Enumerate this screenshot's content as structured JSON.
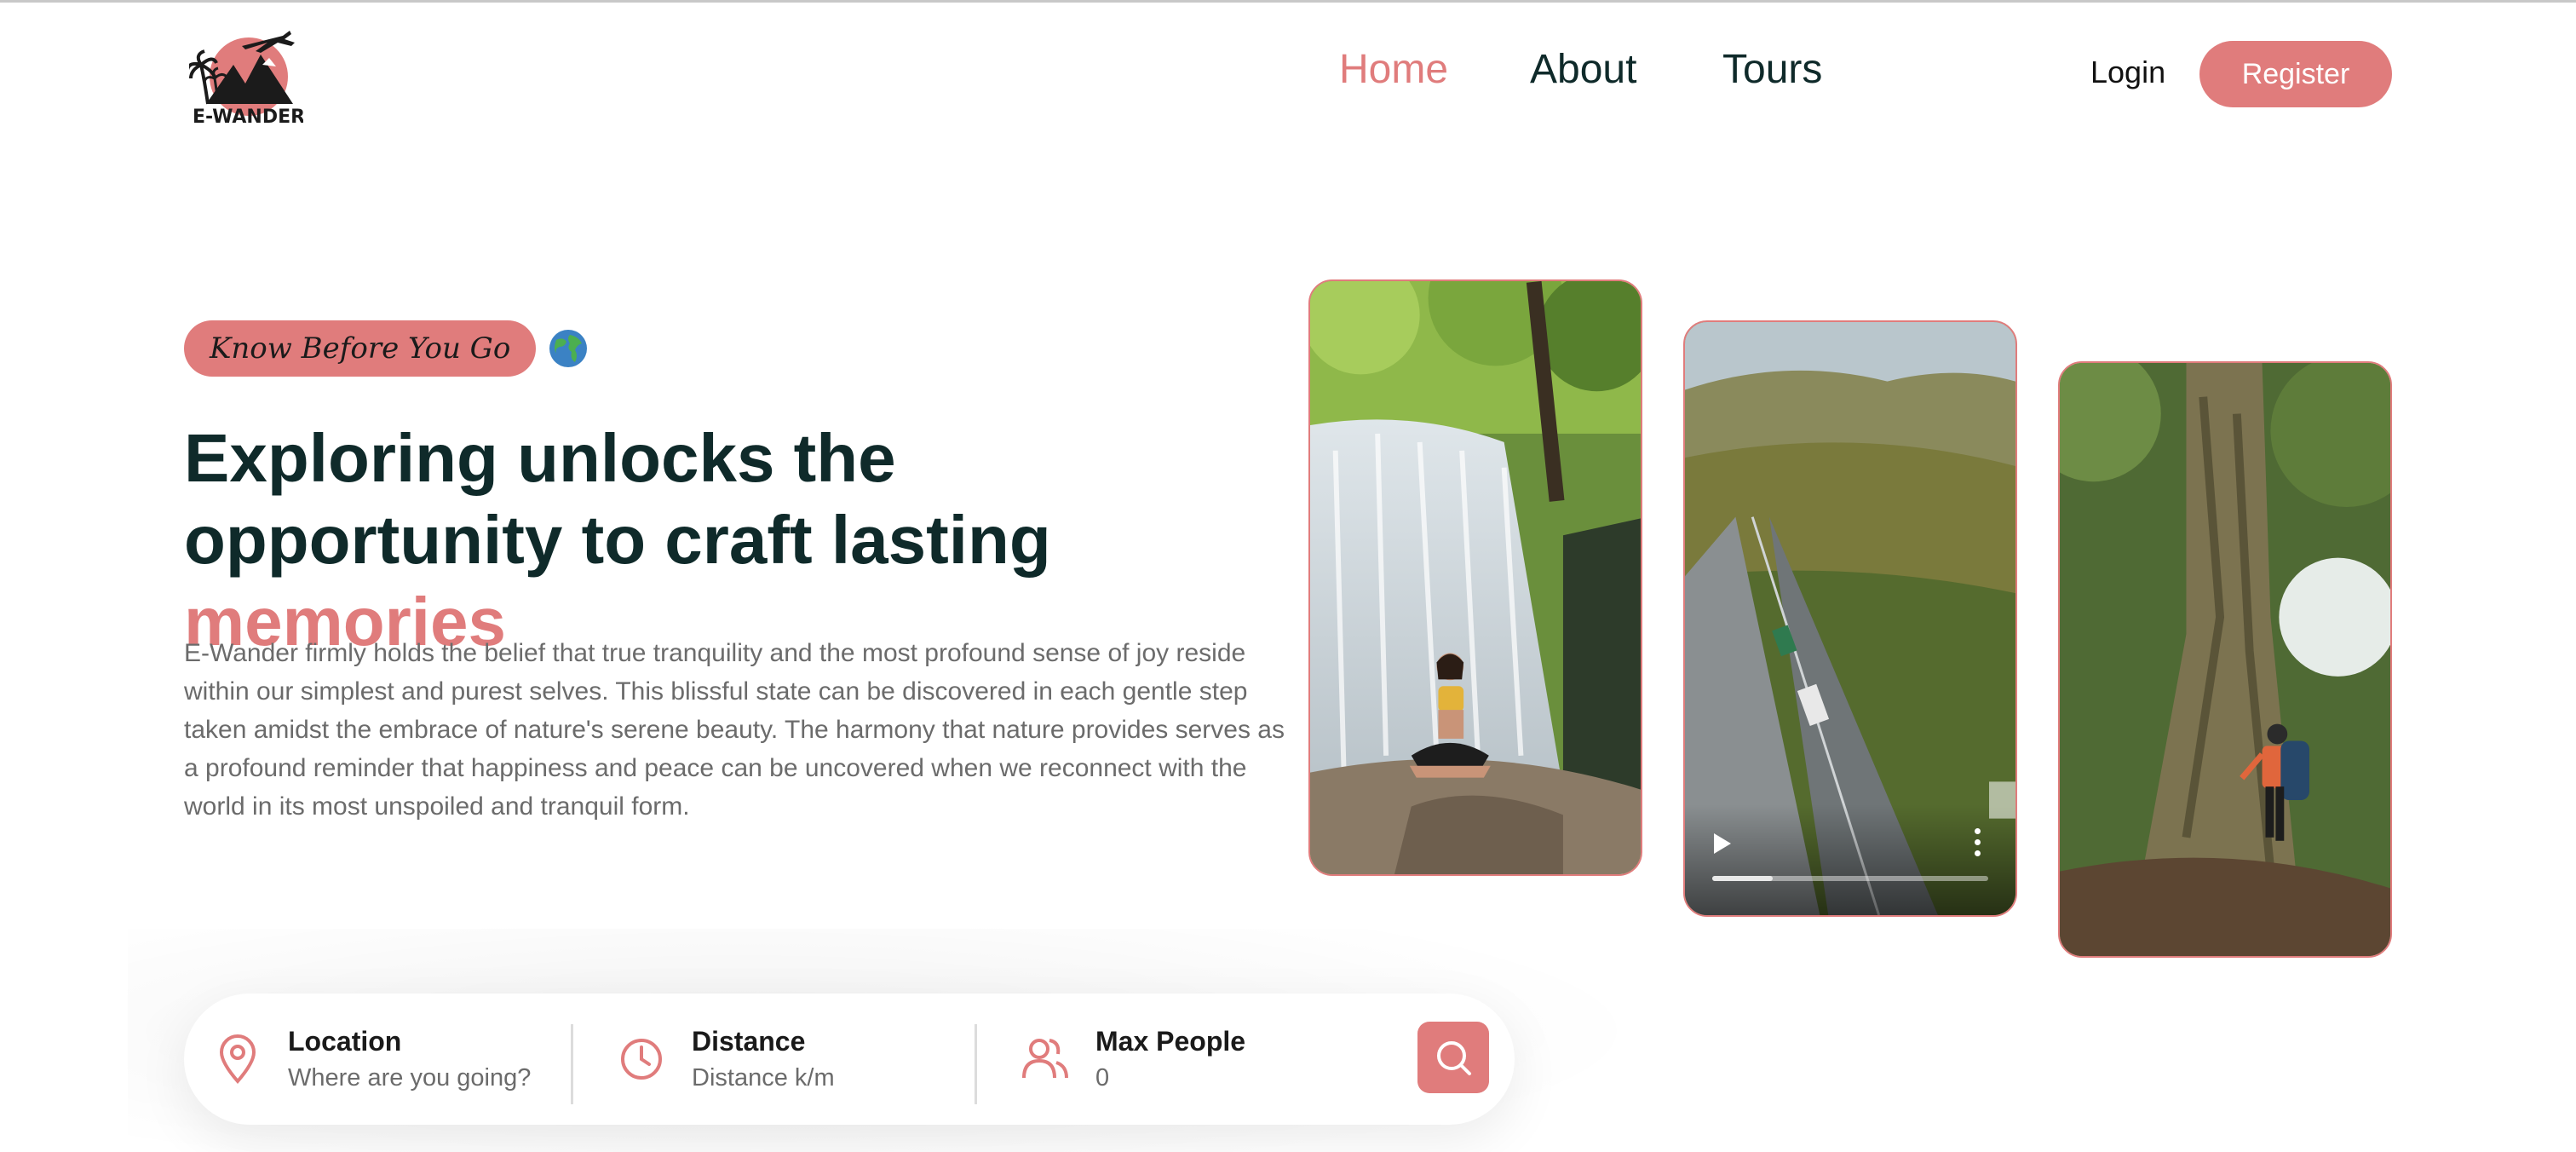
{
  "header": {
    "logo_text": "E-WANDER",
    "nav": [
      {
        "label": "Home",
        "active": true
      },
      {
        "label": "About",
        "active": false
      },
      {
        "label": "Tours",
        "active": false
      }
    ],
    "login_label": "Login",
    "register_label": "Register"
  },
  "hero": {
    "badge": "Know Before You Go",
    "badge_icon": "globe-icon",
    "title_main": "Exploring unlocks the opportunity to craft lasting ",
    "title_accent": "memories",
    "description": "E-Wander firmly holds the belief that true tranquility and the most profound sense of joy reside within our simplest and purest selves. This blissful state can be discovered in each gentle step taken amidst the embrace of nature's serene beauty. The harmony that nature provides serves as a profound reminder that happiness and peace can be uncovered when we reconnect with the world in its most unspoiled and tranquil form.",
    "media": [
      {
        "kind": "image",
        "subject": "woman meditating at waterfall"
      },
      {
        "kind": "video",
        "subject": "aerial highway through mountains",
        "progress": 0.22
      },
      {
        "kind": "image",
        "subject": "hiker beside giant tree"
      }
    ]
  },
  "search": {
    "location": {
      "label": "Location",
      "placeholder": "Where are you going?"
    },
    "distance": {
      "label": "Distance",
      "placeholder": "Distance k/m"
    },
    "people": {
      "label": "Max People",
      "placeholder": "0"
    }
  },
  "colors": {
    "accent": "#e07c7c",
    "heading": "#0f2a2a",
    "body_text": "#6b6b6b"
  }
}
